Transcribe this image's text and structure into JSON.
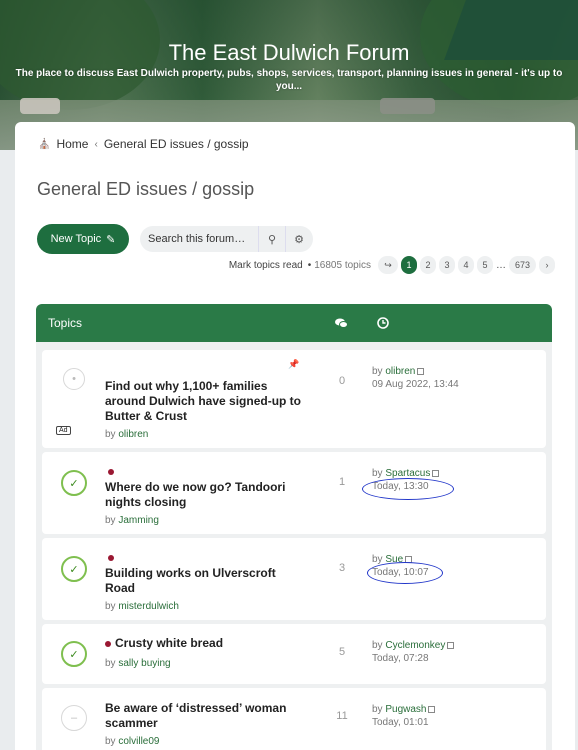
{
  "site": {
    "title": "The East Dulwich Forum",
    "description": "The place to discuss East Dulwich property, pubs, shops, services, transport, planning issues in general - it's up to you..."
  },
  "breadcrumb": {
    "home": "Home",
    "current": "General ED issues / gossip"
  },
  "page_title": "General ED issues / gossip",
  "toolbar": {
    "new_topic": "New Topic",
    "search_placeholder": "Search this forum…"
  },
  "pagination": {
    "mark_read": "Mark topics read",
    "separator": "•",
    "count": "16805 topics",
    "pages": [
      "1",
      "2",
      "3",
      "4",
      "5",
      "…",
      "673"
    ],
    "current": "1"
  },
  "panel": {
    "heading": "Topics"
  },
  "topics": [
    {
      "title": "Find out why 1,100+ families around Dulwich have signed-up to Butter & Crust",
      "by_label": "by",
      "author": "olibren",
      "replies": "0",
      "last_by": "olibren",
      "last_time": "09 Aug 2022, 13:44",
      "badge": "Ad"
    },
    {
      "title": "Where do we now go? Tandoori nights closing",
      "by_label": "by",
      "author": "Jamming",
      "replies": "1",
      "last_by": "Spartacus",
      "last_time": "Today, 13:30"
    },
    {
      "title": "Building works on Ulverscroft Road",
      "by_label": "by",
      "author": "misterdulwich",
      "replies": "3",
      "last_by": "Sue",
      "last_time": "Today, 10:07"
    },
    {
      "title": "Crusty white bread",
      "by_label": "by",
      "author": "sally buying",
      "replies": "5",
      "last_by": "Cyclemonkey",
      "last_time": "Today, 07:28"
    },
    {
      "title": "Be aware of ‘distressed’ woman scammer",
      "by_label": "by",
      "author": "colville09",
      "replies": "11",
      "last_by": "Pugwash",
      "last_time": "Today, 01:01"
    }
  ],
  "colors": {
    "brand_green": "#1e6e3f",
    "header_green": "#2a7a47",
    "unread_dot": "#9a1832",
    "annotation_blue": "#2136c9"
  }
}
